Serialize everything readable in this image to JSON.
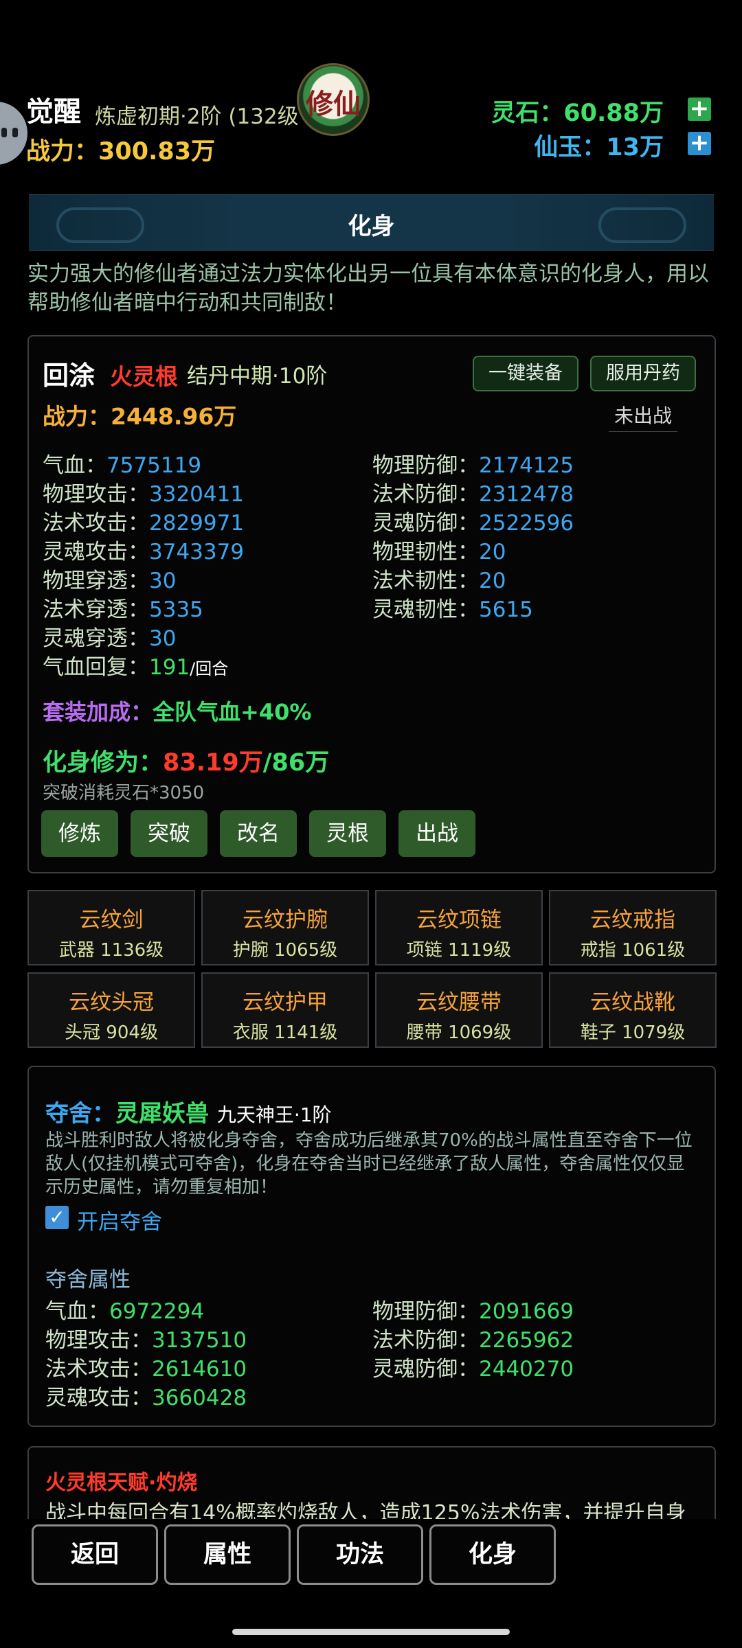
{
  "header": {
    "name": "觉醒",
    "realm": "炼虚初期·2阶 (132级",
    "power_label": "战力：",
    "power_value": "300.83万",
    "logo_text": "修仙",
    "spirit_stone": "灵石：60.88万",
    "immortal_jade": "仙玉：13万",
    "plus": "+"
  },
  "banner": {
    "title": "化身"
  },
  "intro": "实力强大的修仙者通过法力实体化出另一位具有本体意识的化身人，用以帮助修仙者暗中行动和共同制敌！",
  "clone": {
    "name": "回涂",
    "root": "火灵根",
    "realm": "结丹中期·10阶",
    "equip_all": "一键装备",
    "take_pill": "服用丹药",
    "power_label": "战力：",
    "power_value": "2448.96万",
    "status": "未出战",
    "stats_left": [
      {
        "label": "气血：",
        "value": "7575119"
      },
      {
        "label": "物理攻击：",
        "value": "3320411"
      },
      {
        "label": "法术攻击：",
        "value": "2829971"
      },
      {
        "label": "灵魂攻击：",
        "value": "3743379"
      },
      {
        "label": "物理穿透：",
        "value": "30"
      },
      {
        "label": "法术穿透：",
        "value": "5335"
      },
      {
        "label": "灵魂穿透：",
        "value": "30"
      }
    ],
    "stats_right": [
      {
        "label": "物理防御：",
        "value": "2174125"
      },
      {
        "label": "法术防御：",
        "value": "2312478"
      },
      {
        "label": "灵魂防御：",
        "value": "2522596"
      },
      {
        "label": "物理韧性：",
        "value": "20"
      },
      {
        "label": "法术韧性：",
        "value": "20"
      },
      {
        "label": "灵魂韧性：",
        "value": "5615"
      }
    ],
    "regen_label": "气血回复：",
    "regen_value": "191",
    "regen_unit": "/回合",
    "set_bonus_label": "套装加成：",
    "set_bonus_value": "全队气血+40%",
    "cult_label": "化身修为：",
    "cult_current": "83.19万",
    "cult_total": "/86万",
    "break_cost": "突破消耗灵石*3050",
    "buttons": [
      "修炼",
      "突破",
      "改名",
      "灵根",
      "出战"
    ]
  },
  "equipment": [
    {
      "name": "云纹剑",
      "level": "武器 1136级"
    },
    {
      "name": "云纹护腕",
      "level": "护腕 1065级"
    },
    {
      "name": "云纹项链",
      "level": "项链 1119级"
    },
    {
      "name": "云纹戒指",
      "level": "戒指 1061级"
    },
    {
      "name": "云纹头冠",
      "level": "头冠 904级"
    },
    {
      "name": "云纹护甲",
      "level": "衣服 1141级"
    },
    {
      "name": "云纹腰带",
      "level": "腰带 1069级"
    },
    {
      "name": "云纹战靴",
      "level": "鞋子 1079级"
    }
  ],
  "possess": {
    "title": "夺舍：",
    "beast": "灵犀妖兽",
    "rank": "九天神王·1阶",
    "desc": "战斗胜利时敌人将被化身夺舍，夺舍成功后继承其70%的战斗属性直至夺舍下一位敌人(仅挂机模式可夺舍)，化身在夺舍当时已经继承了敌人属性，夺舍属性仅仅显示历史属性，请勿重复相加！",
    "check_mark": "✓",
    "enable_label": "开启夺舍",
    "attr_title": "夺舍属性",
    "attrs_left": [
      {
        "label": "气血：",
        "value": "6972294"
      },
      {
        "label": "物理攻击：",
        "value": "3137510"
      },
      {
        "label": "法术攻击：",
        "value": "2614610"
      },
      {
        "label": "灵魂攻击：",
        "value": "3660428"
      }
    ],
    "attrs_right": [
      {
        "label": "物理防御：",
        "value": "2091669"
      },
      {
        "label": "法术防御：",
        "value": "2265962"
      },
      {
        "label": "灵魂防御：",
        "value": "2440270"
      }
    ]
  },
  "talent": {
    "title": "火灵根天赋·灼烧",
    "desc": "战斗中每回合有14%概率灼烧敌人，造成125%法术伤害，并提升自身"
  },
  "nav": [
    "返回",
    "属性",
    "功法",
    "化身"
  ],
  "colors": {
    "gold": "#f6c83d",
    "green": "#3fe06b",
    "blue": "#3fa6f0",
    "red": "#ff3b2b",
    "purple": "#b86cf0",
    "orange": "#f6a23a"
  }
}
